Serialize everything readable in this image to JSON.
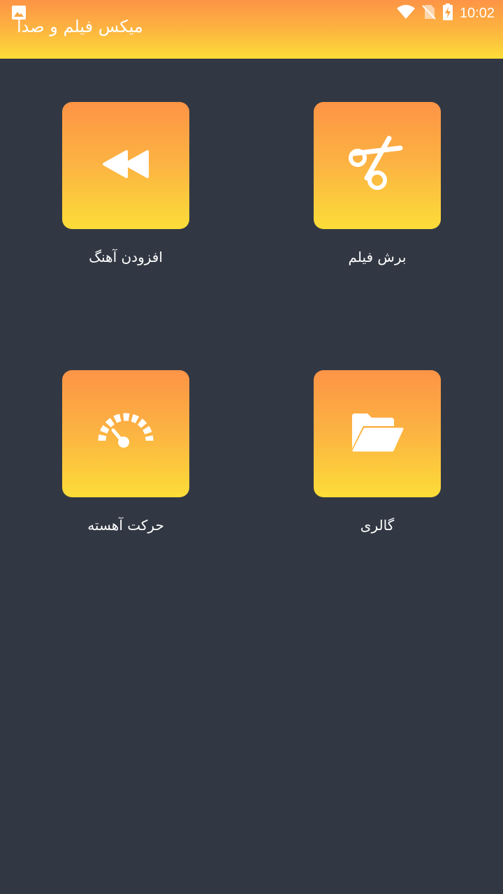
{
  "status_bar": {
    "time": "10:02",
    "icons": [
      "image-notification-icon",
      "wifi-icon",
      "no-sim-icon",
      "battery-charging-icon"
    ]
  },
  "app_bar": {
    "title": "میکس فیلم و صدا"
  },
  "grid": {
    "items": [
      {
        "label": "برش فیلم",
        "icon": "scissors-icon"
      },
      {
        "label": "افزودن آهنگ",
        "icon": "rewind-icon"
      },
      {
        "label": "گالری",
        "icon": "folder-open-icon"
      },
      {
        "label": "حرکت آهسته",
        "icon": "speedometer-icon"
      }
    ]
  },
  "colors": {
    "background": "#323843",
    "gradient_top": "#fd9446",
    "gradient_bottom": "#fcdd38",
    "text": "#ffffff"
  }
}
